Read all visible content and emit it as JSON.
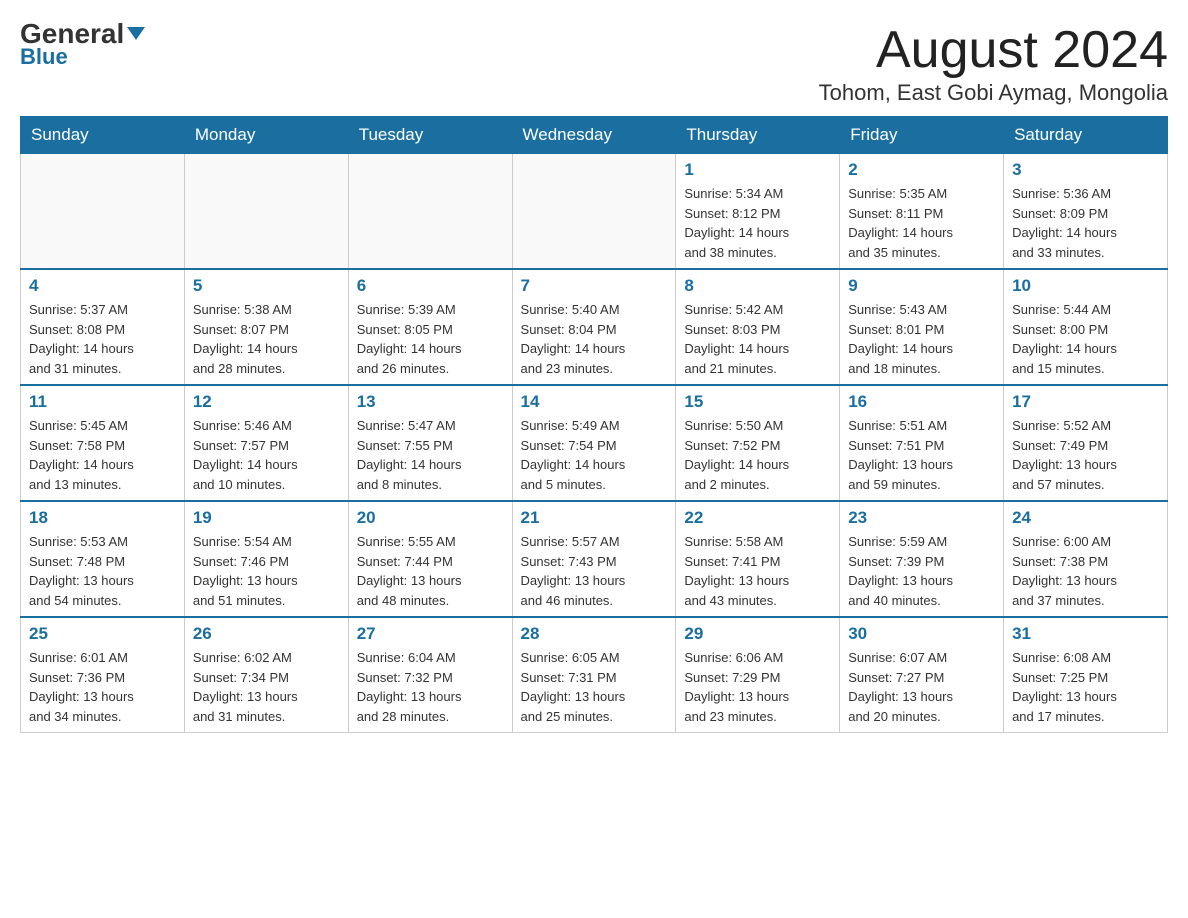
{
  "logo": {
    "part1": "General",
    "part2": "Blue"
  },
  "header": {
    "month_year": "August 2024",
    "location": "Tohom, East Gobi Aymag, Mongolia"
  },
  "days_of_week": [
    "Sunday",
    "Monday",
    "Tuesday",
    "Wednesday",
    "Thursday",
    "Friday",
    "Saturday"
  ],
  "weeks": [
    [
      {
        "day": "",
        "info": ""
      },
      {
        "day": "",
        "info": ""
      },
      {
        "day": "",
        "info": ""
      },
      {
        "day": "",
        "info": ""
      },
      {
        "day": "1",
        "info": "Sunrise: 5:34 AM\nSunset: 8:12 PM\nDaylight: 14 hours\nand 38 minutes."
      },
      {
        "day": "2",
        "info": "Sunrise: 5:35 AM\nSunset: 8:11 PM\nDaylight: 14 hours\nand 35 minutes."
      },
      {
        "day": "3",
        "info": "Sunrise: 5:36 AM\nSunset: 8:09 PM\nDaylight: 14 hours\nand 33 minutes."
      }
    ],
    [
      {
        "day": "4",
        "info": "Sunrise: 5:37 AM\nSunset: 8:08 PM\nDaylight: 14 hours\nand 31 minutes."
      },
      {
        "day": "5",
        "info": "Sunrise: 5:38 AM\nSunset: 8:07 PM\nDaylight: 14 hours\nand 28 minutes."
      },
      {
        "day": "6",
        "info": "Sunrise: 5:39 AM\nSunset: 8:05 PM\nDaylight: 14 hours\nand 26 minutes."
      },
      {
        "day": "7",
        "info": "Sunrise: 5:40 AM\nSunset: 8:04 PM\nDaylight: 14 hours\nand 23 minutes."
      },
      {
        "day": "8",
        "info": "Sunrise: 5:42 AM\nSunset: 8:03 PM\nDaylight: 14 hours\nand 21 minutes."
      },
      {
        "day": "9",
        "info": "Sunrise: 5:43 AM\nSunset: 8:01 PM\nDaylight: 14 hours\nand 18 minutes."
      },
      {
        "day": "10",
        "info": "Sunrise: 5:44 AM\nSunset: 8:00 PM\nDaylight: 14 hours\nand 15 minutes."
      }
    ],
    [
      {
        "day": "11",
        "info": "Sunrise: 5:45 AM\nSunset: 7:58 PM\nDaylight: 14 hours\nand 13 minutes."
      },
      {
        "day": "12",
        "info": "Sunrise: 5:46 AM\nSunset: 7:57 PM\nDaylight: 14 hours\nand 10 minutes."
      },
      {
        "day": "13",
        "info": "Sunrise: 5:47 AM\nSunset: 7:55 PM\nDaylight: 14 hours\nand 8 minutes."
      },
      {
        "day": "14",
        "info": "Sunrise: 5:49 AM\nSunset: 7:54 PM\nDaylight: 14 hours\nand 5 minutes."
      },
      {
        "day": "15",
        "info": "Sunrise: 5:50 AM\nSunset: 7:52 PM\nDaylight: 14 hours\nand 2 minutes."
      },
      {
        "day": "16",
        "info": "Sunrise: 5:51 AM\nSunset: 7:51 PM\nDaylight: 13 hours\nand 59 minutes."
      },
      {
        "day": "17",
        "info": "Sunrise: 5:52 AM\nSunset: 7:49 PM\nDaylight: 13 hours\nand 57 minutes."
      }
    ],
    [
      {
        "day": "18",
        "info": "Sunrise: 5:53 AM\nSunset: 7:48 PM\nDaylight: 13 hours\nand 54 minutes."
      },
      {
        "day": "19",
        "info": "Sunrise: 5:54 AM\nSunset: 7:46 PM\nDaylight: 13 hours\nand 51 minutes."
      },
      {
        "day": "20",
        "info": "Sunrise: 5:55 AM\nSunset: 7:44 PM\nDaylight: 13 hours\nand 48 minutes."
      },
      {
        "day": "21",
        "info": "Sunrise: 5:57 AM\nSunset: 7:43 PM\nDaylight: 13 hours\nand 46 minutes."
      },
      {
        "day": "22",
        "info": "Sunrise: 5:58 AM\nSunset: 7:41 PM\nDaylight: 13 hours\nand 43 minutes."
      },
      {
        "day": "23",
        "info": "Sunrise: 5:59 AM\nSunset: 7:39 PM\nDaylight: 13 hours\nand 40 minutes."
      },
      {
        "day": "24",
        "info": "Sunrise: 6:00 AM\nSunset: 7:38 PM\nDaylight: 13 hours\nand 37 minutes."
      }
    ],
    [
      {
        "day": "25",
        "info": "Sunrise: 6:01 AM\nSunset: 7:36 PM\nDaylight: 13 hours\nand 34 minutes."
      },
      {
        "day": "26",
        "info": "Sunrise: 6:02 AM\nSunset: 7:34 PM\nDaylight: 13 hours\nand 31 minutes."
      },
      {
        "day": "27",
        "info": "Sunrise: 6:04 AM\nSunset: 7:32 PM\nDaylight: 13 hours\nand 28 minutes."
      },
      {
        "day": "28",
        "info": "Sunrise: 6:05 AM\nSunset: 7:31 PM\nDaylight: 13 hours\nand 25 minutes."
      },
      {
        "day": "29",
        "info": "Sunrise: 6:06 AM\nSunset: 7:29 PM\nDaylight: 13 hours\nand 23 minutes."
      },
      {
        "day": "30",
        "info": "Sunrise: 6:07 AM\nSunset: 7:27 PM\nDaylight: 13 hours\nand 20 minutes."
      },
      {
        "day": "31",
        "info": "Sunrise: 6:08 AM\nSunset: 7:25 PM\nDaylight: 13 hours\nand 17 minutes."
      }
    ]
  ]
}
